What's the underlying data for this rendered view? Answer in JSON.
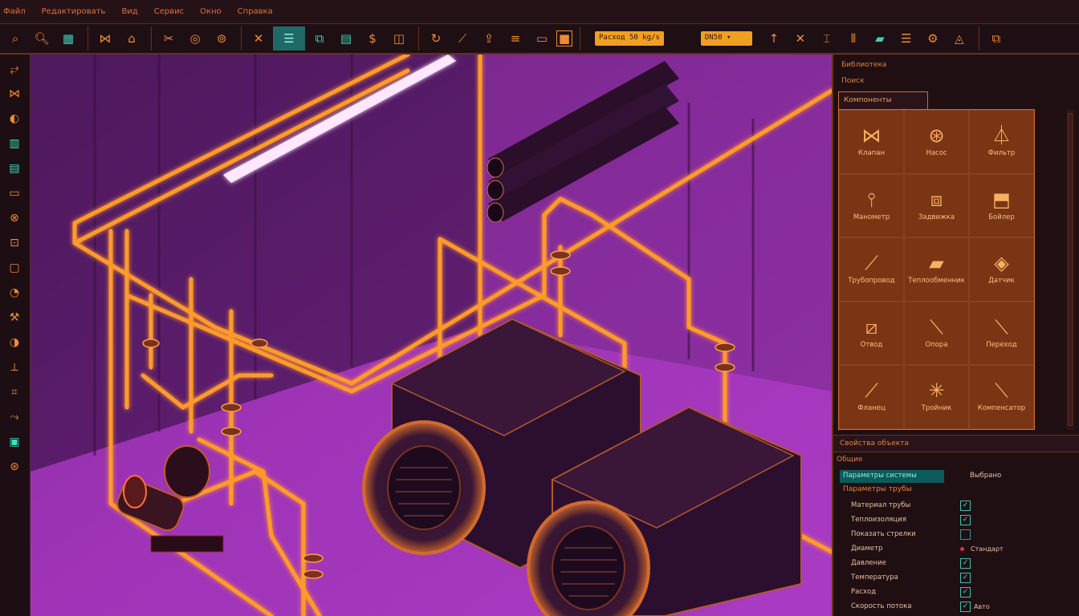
{
  "menu": [
    "Файл",
    "Редактировать",
    "Вид",
    "Сервис",
    "Окно",
    "Справка"
  ],
  "toolbar": {
    "field1": "Расход 50 kg/s",
    "field2": "DN50 ▾",
    "icons": [
      "search-icon",
      "zoom-icon",
      "grid-icon",
      "valve-icon",
      "pump-icon",
      "scissors-icon",
      "flow-icon",
      "target-icon",
      "close-icon",
      "list-icon",
      "component-icon",
      "table-icon",
      "dollar-icon",
      "box-icon",
      "rotate-icon",
      "measure-icon",
      "export-icon",
      "layers-icon",
      "panel-icon",
      "square-icon"
    ]
  },
  "leftbar": {
    "icons": [
      "pipe-icon",
      "valve-icon",
      "fitting-icon",
      "tank-icon",
      "heater-icon",
      "monitor-icon",
      "filter-icon",
      "connector-icon",
      "screen-icon",
      "gauge-icon",
      "tool-icon",
      "flange-icon",
      "axis-icon",
      "graph-icon",
      "arrow-icon",
      "teal-box-icon",
      "pump-icon"
    ]
  },
  "panel": {
    "title": "Библиотека",
    "subtitle": "Поиск",
    "tab": "Компоненты",
    "components": [
      {
        "label": "Клапан",
        "icon": "valve-icon"
      },
      {
        "label": "Насос",
        "icon": "pump-icon"
      },
      {
        "label": "Фильтр",
        "icon": "filter-icon"
      },
      {
        "label": "Манометр",
        "icon": "gauge-icon"
      },
      {
        "label": "Задвижка",
        "icon": "gate-valve-icon"
      },
      {
        "label": "Бойлер",
        "icon": "boiler-icon"
      },
      {
        "label": "Трубопровод",
        "icon": "pipe-icon"
      },
      {
        "label": "Теплообменник",
        "icon": "exchanger-icon"
      },
      {
        "label": "Датчик",
        "icon": "sensor-icon"
      },
      {
        "label": "Отвод",
        "icon": "elbow-icon"
      },
      {
        "label": "Опора",
        "icon": "support-icon"
      },
      {
        "label": "Переход",
        "icon": "reducer-icon"
      },
      {
        "label": "Фланец",
        "icon": "flange-icon"
      },
      {
        "label": "Тройник",
        "icon": "tee-icon"
      },
      {
        "label": "Компенсатор",
        "icon": "compensator-icon"
      }
    ],
    "props_title": "Свойства объекта",
    "props_sub": "Общие",
    "selected_label": "Параметры системы",
    "selected_value": "Выбрано",
    "group": "Параметры трубы",
    "rows": [
      {
        "label": "Материал трубы",
        "checked": true,
        "value": ""
      },
      {
        "label": "Теплоизоляция",
        "checked": true,
        "value": ""
      },
      {
        "label": "Показать стрелки",
        "checked": false,
        "value": ""
      },
      {
        "label": "Диаметр",
        "checked": false,
        "value": "Стандарт",
        "dot": true
      },
      {
        "label": "Давление",
        "checked": true,
        "value": ""
      },
      {
        "label": "Температура",
        "checked": true,
        "value": ""
      },
      {
        "label": "Расход",
        "checked": true,
        "value": ""
      },
      {
        "label": "Скорость потока",
        "checked": true,
        "value": "Авто"
      }
    ]
  },
  "colors": {
    "accent": "#f08a30",
    "glow": "#ffb040",
    "teal": "#3fe0c0",
    "viewport_bg": "#8a2ca0"
  }
}
